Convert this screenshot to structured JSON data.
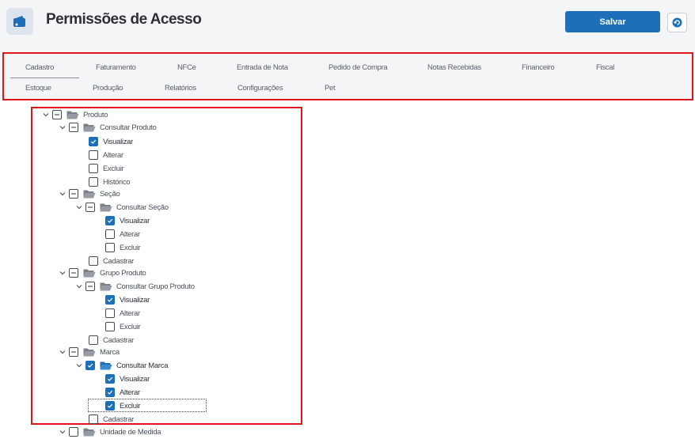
{
  "header": {
    "title": "Permissões de Acesso",
    "save_label": "Salvar"
  },
  "tabs_row1": [
    "Cadastro",
    "Faturamento",
    "NFCe",
    "Entrada de Nota",
    "Pedido de Compra",
    "Notas Recebidas",
    "Financeiro",
    "Fiscal"
  ],
  "tabs_row2": [
    "Estoque",
    "Produção",
    "Relatórios",
    "Configurações",
    "Pet"
  ],
  "tree": {
    "produto": "Produto",
    "consultar_produto": "Consultar Produto",
    "visualizar": "Visualizar",
    "alterar": "Alterar",
    "excluir": "Excluir",
    "historico": "Histórico",
    "secao": "Seção",
    "consultar_secao": "Consultar Seção",
    "cadastrar": "Cadastrar",
    "grupo_produto": "Grupo Produto",
    "consultar_grupo_produto": "Consultar Grupo Produto",
    "marca": "Marca",
    "consultar_marca": "Consultar Marca",
    "unidade_medida": "Unidade de Medida"
  },
  "colors": {
    "accent": "#1d6fb8",
    "highlight": "#e0141c"
  }
}
